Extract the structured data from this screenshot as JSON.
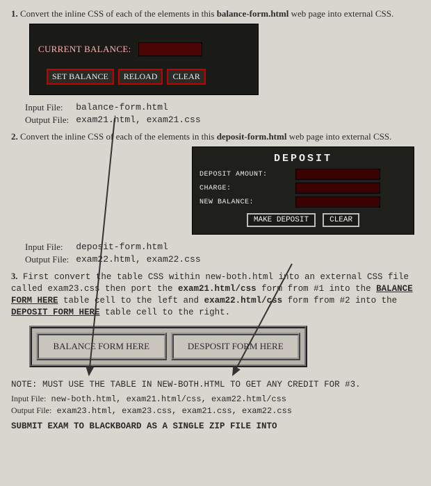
{
  "q1": {
    "num": "1.",
    "text_a": "Convert the inline CSS of each of the elements in this ",
    "bold": "balance-form.html",
    "text_b": " web page into external CSS."
  },
  "balance_panel": {
    "label": "CURRENT BALANCE:",
    "buttons": {
      "set": "SET BALANCE",
      "reload": "RELOAD",
      "clear": "CLEAR"
    }
  },
  "io1": {
    "in_lbl": "Input File:",
    "in_val": "balance-form.html",
    "out_lbl": "Output File:",
    "out_val": "exam21.html, exam21.css"
  },
  "q2": {
    "num": "2.",
    "text_a": "Convert the inline CSS of each of the elements in this ",
    "bold": "deposit-form.html",
    "text_b": " web page into external CSS."
  },
  "deposit_panel": {
    "title": "DEPOSIT",
    "rows": {
      "amount": "DEPOSIT AMOUNT:",
      "charge": "CHARGE:",
      "newbal": "NEW BALANCE:"
    },
    "buttons": {
      "make": "MAKE DEPOSIT",
      "clear": "CLEAR"
    }
  },
  "io2": {
    "in_lbl": "Input File:",
    "in_val": "deposit-form.html",
    "out_lbl": "Output File:",
    "out_val": "exam22.html, exam22.css"
  },
  "q3": {
    "num": "3.",
    "a": "First convert the table CSS within new-both.html into an external CSS file called exam23.css  then port the ",
    "b": "exam21.html/css",
    "c": " form from #1 into the ",
    "d": "BALANCE FORM HERE",
    "e": " table cell to the left and ",
    "f": "exam22.html/css",
    "g": " form from #2 into the ",
    "h": "DEPOSIT FORM HERE",
    "i": " table cell to the right."
  },
  "both_table": {
    "left": "BALANCE FORM HERE",
    "right": "DESPOSIT FORM HERE"
  },
  "note": "NOTE: MUST USE THE TABLE IN NEW-BOTH.HTML TO GET ANY CREDIT FOR #3.",
  "io3": {
    "in_lbl": "Input File:",
    "in_val": "new-both.html, exam21.html/css, exam22.html/css",
    "out_lbl": "Output File:",
    "out_val": "exam23.html, exam23.css, exam21.css, exam22.css"
  },
  "submit": "SUBMIT EXAM TO BLACKBOARD AS A SINGLE ZIP FILE INTO"
}
